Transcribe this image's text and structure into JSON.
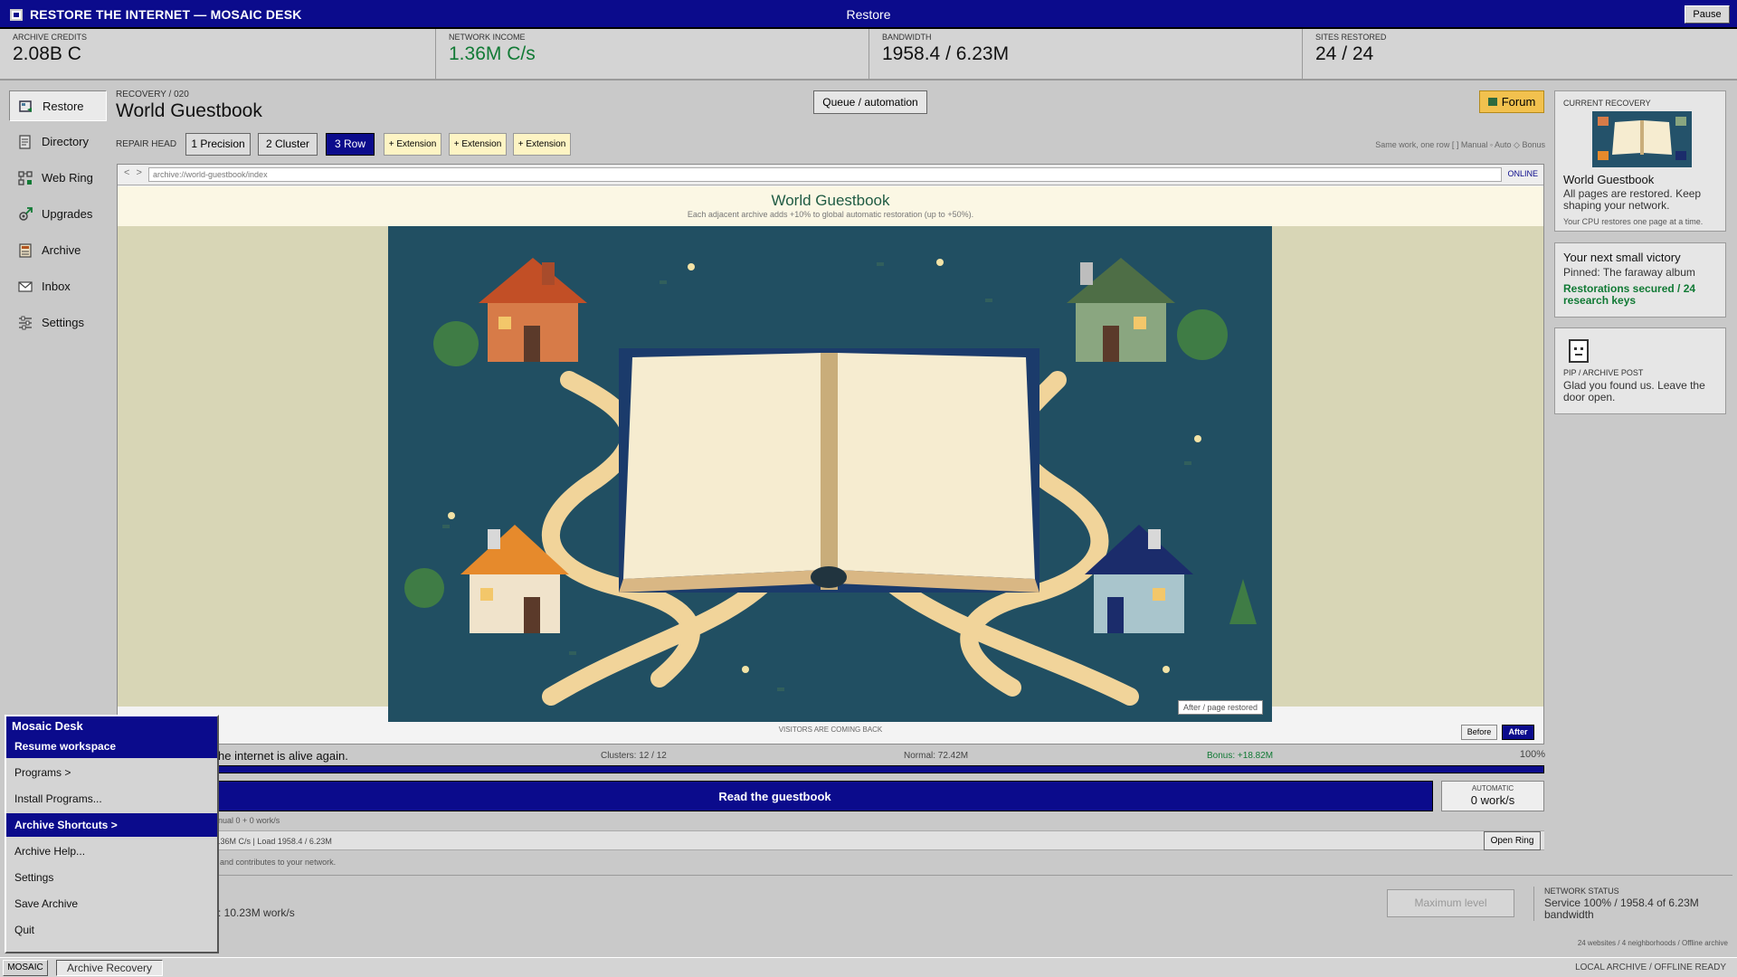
{
  "window": {
    "app_title": "RESTORE THE INTERNET — MOSAIC DESK",
    "center_title": "Restore",
    "pause_label": "Pause"
  },
  "stats": [
    {
      "label": "ARCHIVE CREDITS",
      "value": "2.08B C"
    },
    {
      "label": "NETWORK INCOME",
      "value": "1.36M C/s"
    },
    {
      "label": "BANDWIDTH",
      "value": "1958.4 / 6.23M"
    },
    {
      "label": "SITES RESTORED",
      "value": "24 / 24"
    }
  ],
  "sidebar": {
    "items": [
      {
        "label": "Restore",
        "icon": "restore-icon",
        "active": true
      },
      {
        "label": "Directory",
        "icon": "directory-icon"
      },
      {
        "label": "Web Ring",
        "icon": "web-ring-icon"
      },
      {
        "label": "Upgrades",
        "icon": "upgrades-icon"
      },
      {
        "label": "Archive",
        "icon": "archive-icon"
      },
      {
        "label": "Inbox",
        "icon": "inbox-icon"
      },
      {
        "label": "Settings",
        "icon": "settings-icon"
      }
    ]
  },
  "main": {
    "recovery_label": "RECOVERY / 020",
    "title": "World Guestbook",
    "queue_label": "Queue / automation",
    "forum_label": "Forum",
    "repair_head_label": "REPAIR HEAD",
    "chips": [
      "1 Precision",
      "2 Cluster",
      "3 Row",
      "+ Extension",
      "+ Extension",
      "+ Extension"
    ],
    "legend": "Same work, one row   [ ] Manual  ◦ Auto  ◇ Bonus"
  },
  "browser": {
    "url": "archive://world-guestbook/index",
    "status": "ONLINE",
    "site_title": "World Guestbook",
    "site_subtitle": "Each adjacent archive adds +10% to global automatic restoration (up to +50%).",
    "after_badge": "After / page restored",
    "visitors_label": "VISITORS ARE COMING BACK",
    "before_label": "Before",
    "after_label": "After"
  },
  "progress": {
    "message": "he internet is alive again.",
    "clusters": "Clusters: 12 / 12",
    "normal": "Normal: 72.42M",
    "bonus": "Bonus: +18.82M",
    "percent": "100%",
    "fill": 1.0
  },
  "actions": {
    "read_label": "Read the guestbook",
    "automatic_label": "AUTOMATIC",
    "automatic_value": "0 work/s",
    "manual_line": "nual 0 + 0 work/s",
    "income_line": ".36M C/s  |  Load 1958.4 / 6.23M",
    "open_ring_label": "Open Ring",
    "contrib_line": "and contributes to your network.",
    "work_rate": ": 10.23M work/s",
    "max_label": "Maximum level",
    "network_status_label": "NETWORK STATUS",
    "network_status_value": "Service 100% / 1958.4 of 6.23M bandwidth",
    "footer_note": "24 websites / 4 neighborhoods / Offline archive"
  },
  "right_panel": {
    "current_label": "CURRENT RECOVERY",
    "current_title": "World Guestbook",
    "current_body": "All pages are restored. Keep shaping your network.",
    "current_small": "Your CPU restores one page at a time.",
    "victory_title": "Your next small victory",
    "victory_body": "Pinned: The faraway album",
    "victory_green": "Restorations secured / 24 research keys",
    "pip_label": "PIP / ARCHIVE POST",
    "pip_body": "Glad you found us. Leave the door open."
  },
  "start_menu": {
    "header": "Mosaic Desk",
    "items": [
      {
        "label": "Resume workspace",
        "selected": true
      },
      {
        "label": "Programs >"
      },
      {
        "label": "Install Programs..."
      },
      {
        "label": "Archive Shortcuts >",
        "selected": true
      },
      {
        "label": "Archive Help..."
      },
      {
        "label": "Settings"
      },
      {
        "label": "Save Archive"
      },
      {
        "label": "Quit"
      }
    ]
  },
  "taskbar": {
    "start_label": "MOSAIC",
    "app_label": "Archive Recovery",
    "status": "LOCAL ARCHIVE  /  OFFLINE READY"
  },
  "colors": {
    "accent": "#0b0b8c",
    "green": "#117a35",
    "forum": "#f2c14e",
    "extension_chip": "#fdf4c4"
  }
}
